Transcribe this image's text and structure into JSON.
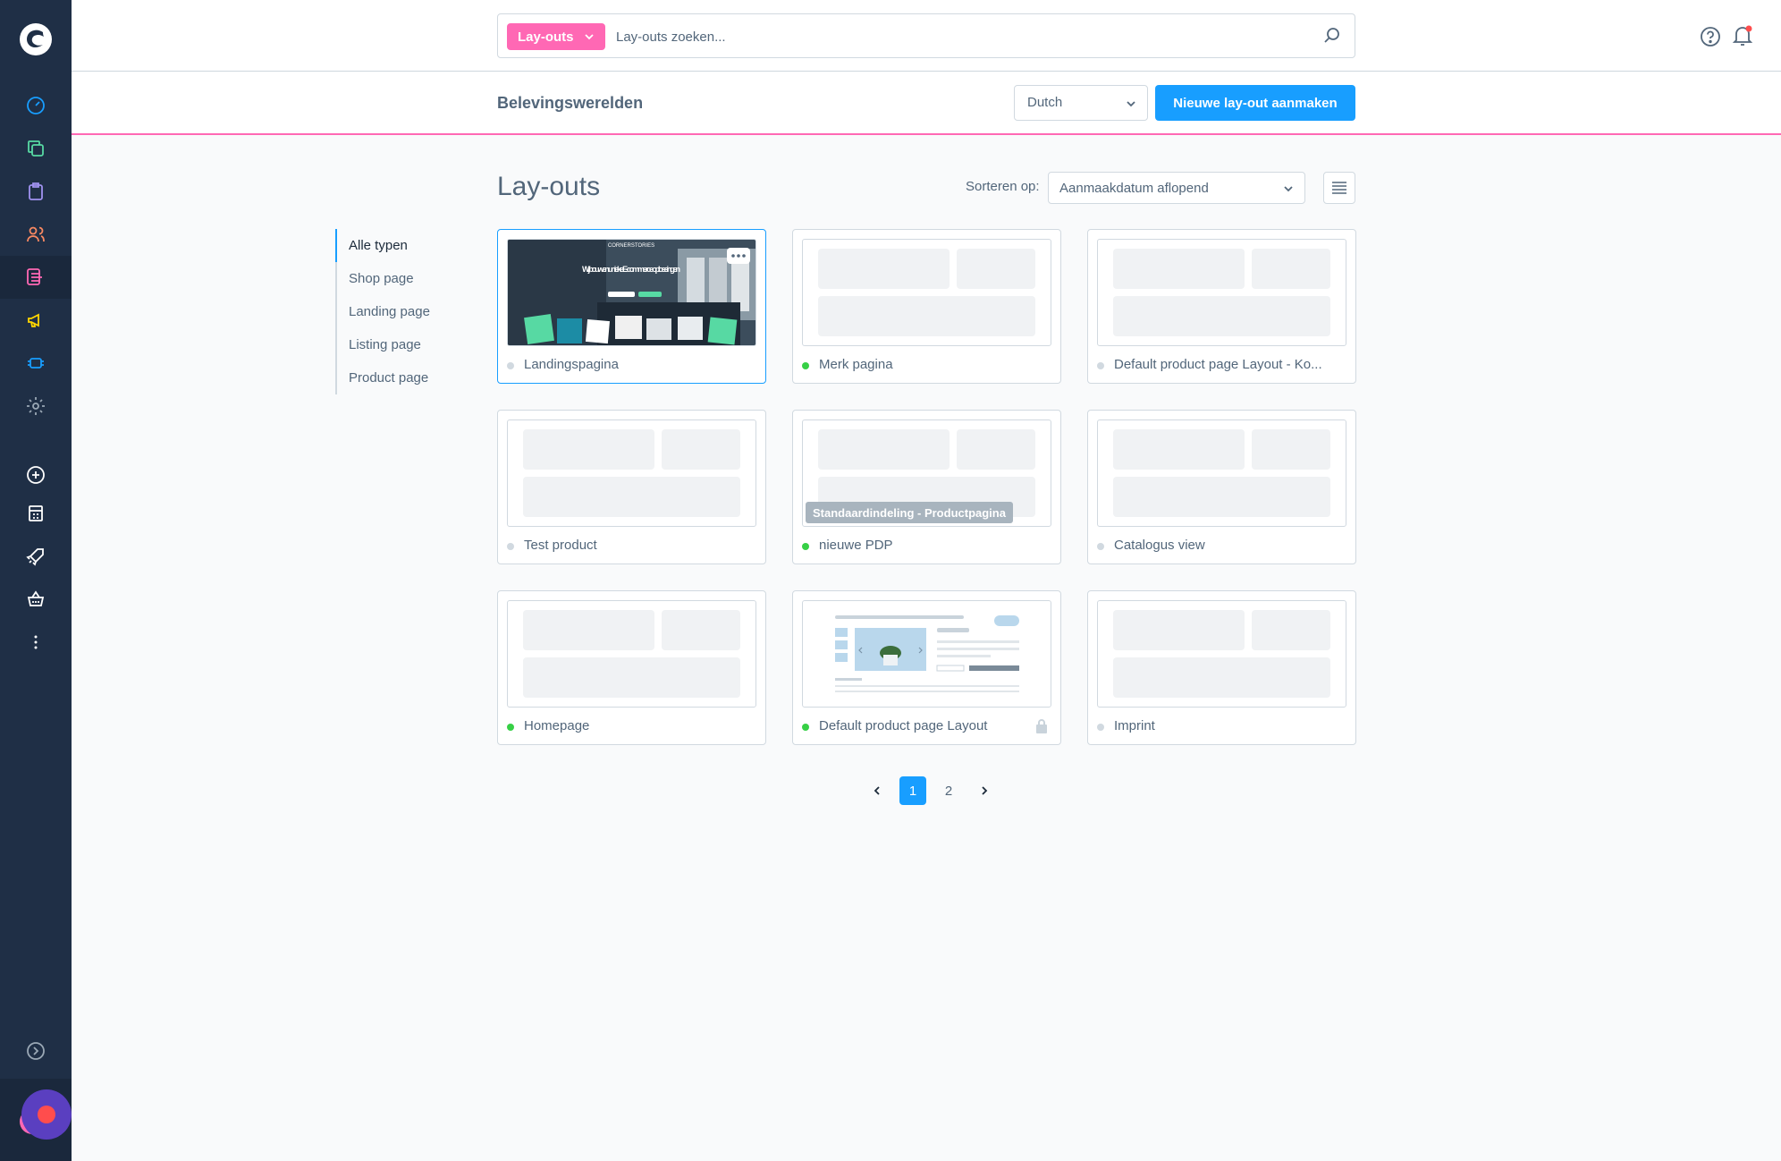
{
  "search": {
    "module_label": "Lay-outs",
    "placeholder": "Lay-outs zoeken..."
  },
  "smartbar": {
    "title": "Belevingswerelden",
    "language": "Dutch",
    "create_button": "Nieuwe lay-out aanmaken"
  },
  "content": {
    "title": "Lay-outs",
    "sort_label": "Sorteren op:",
    "sort_value": "Aanmaakdatum aflopend"
  },
  "type_filters": [
    "Alle typen",
    "Shop page",
    "Landing page",
    "Listing page",
    "Product page"
  ],
  "layouts": [
    {
      "name": "Landingspagina",
      "status": "inactive",
      "preview": "image",
      "preview_text": "Wij bouwen unieke E-commerce oplossingen",
      "preview_brand": "CORNERSTORIES"
    },
    {
      "name": "Merk pagina",
      "status": "active",
      "preview": "placeholder"
    },
    {
      "name": "Default product page Layout - Ko...",
      "status": "inactive",
      "preview": "placeholder"
    },
    {
      "name": "Test product",
      "status": "inactive",
      "preview": "placeholder"
    },
    {
      "name": "nieuwe PDP",
      "status": "active",
      "preview": "placeholder",
      "badge": "Standaardindeling - Productpagina"
    },
    {
      "name": "Catalogus view",
      "status": "inactive",
      "preview": "placeholder"
    },
    {
      "name": "Homepage",
      "status": "active",
      "preview": "placeholder"
    },
    {
      "name": "Default product page Layout",
      "status": "active",
      "preview": "product",
      "locked": true
    },
    {
      "name": "Imprint",
      "status": "inactive",
      "preview": "placeholder"
    }
  ],
  "pagination": {
    "pages": [
      "1",
      "2"
    ],
    "current": "1"
  },
  "colors": {
    "sidebar": "#1f2f46",
    "accent": "#189eff",
    "module": "#ff68b4",
    "active_dot": "#37d046",
    "inactive_dot": "#d1d9e0"
  },
  "sidebar_icons": [
    "dashboard-icon",
    "catalogues-icon",
    "orders-icon",
    "customers-icon",
    "content-icon",
    "marketing-icon",
    "extensions-icon",
    "settings-icon",
    "add-icon",
    "store-icon",
    "rocket-icon",
    "basket-icon",
    "more-icon",
    "collapse-icon"
  ]
}
